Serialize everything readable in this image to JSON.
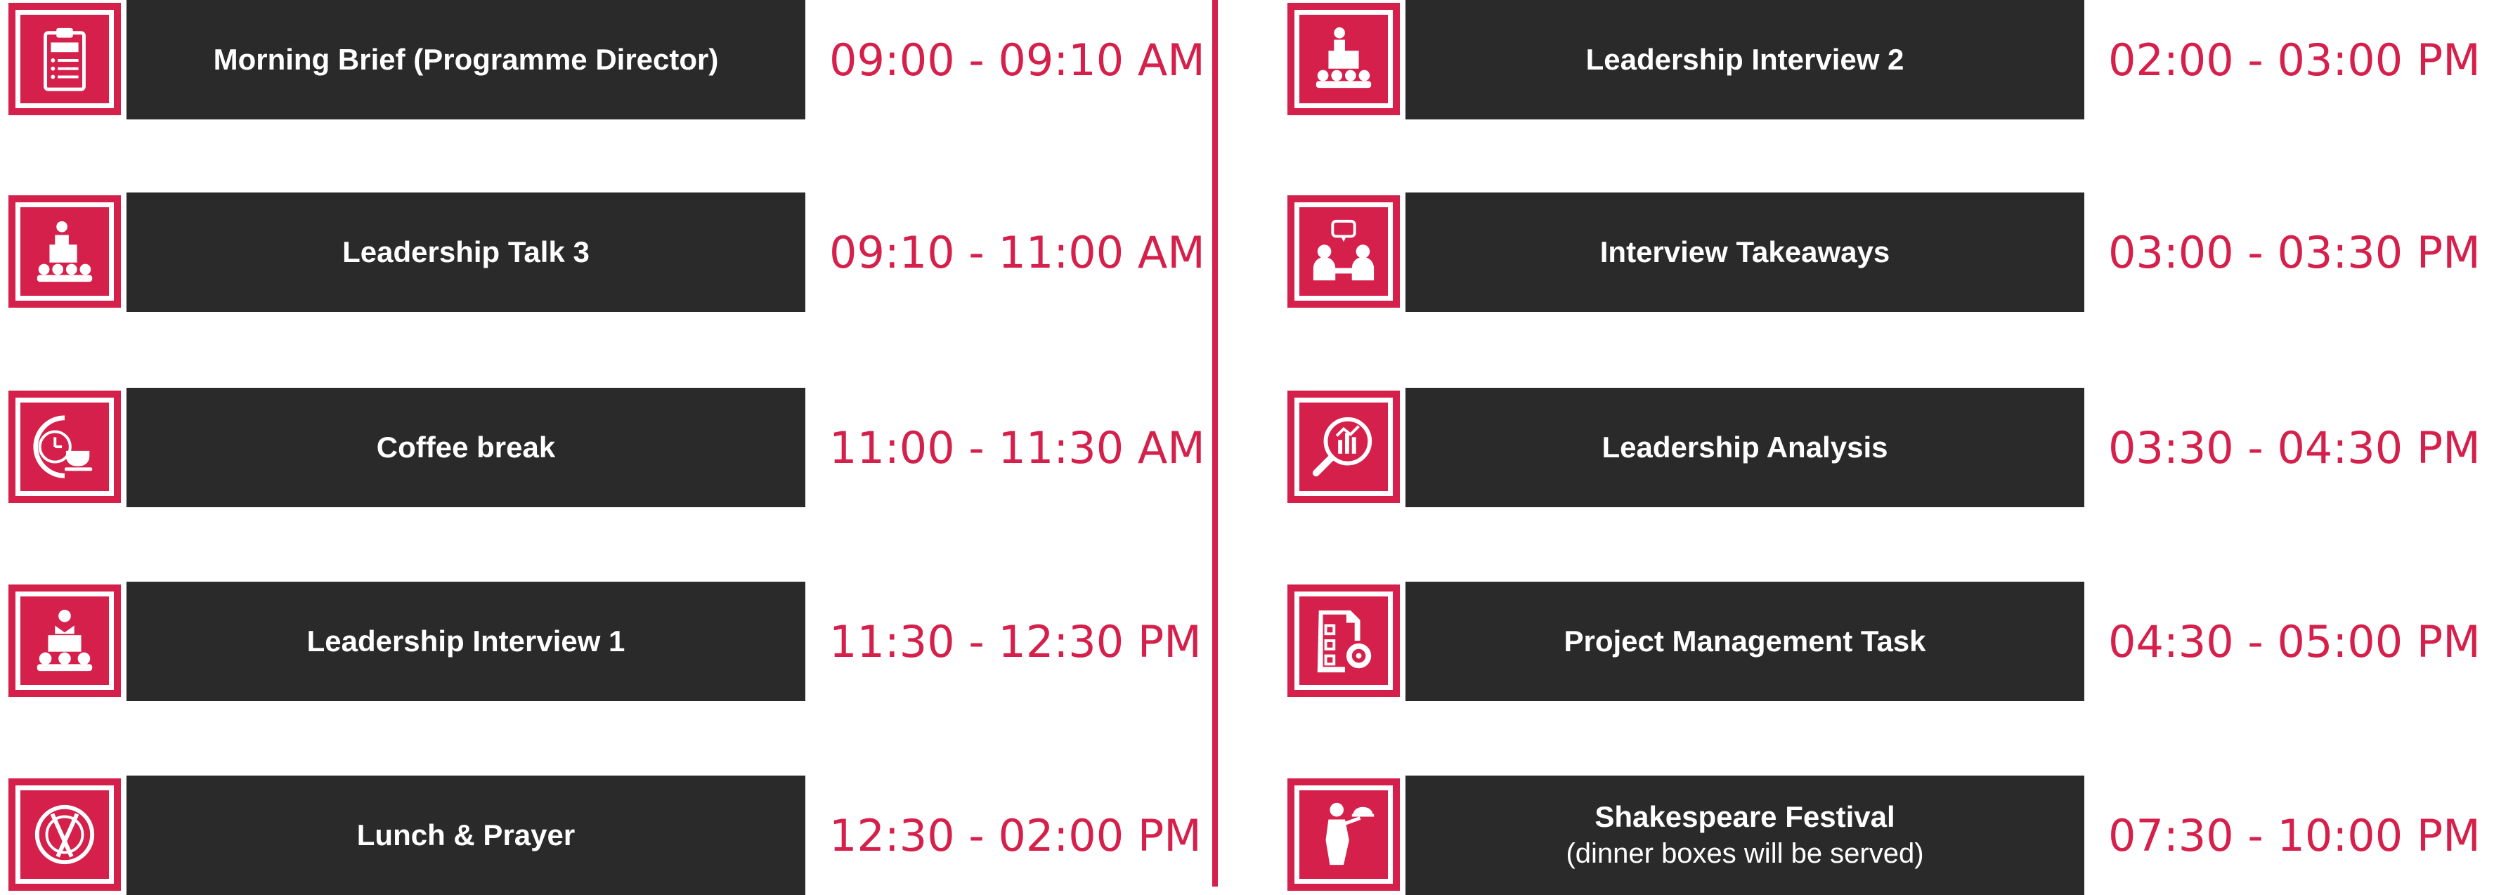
{
  "colors": {
    "accent": "#d4204a",
    "title_bg": "#2a2a2a",
    "title_text": "#ffffff",
    "time_text": "#d4204a"
  },
  "schedule": {
    "left": [
      {
        "icon": "brief-clipboard-icon",
        "title": "Morning Brief (Programme Director)",
        "subtitle": "",
        "time": "09:00 - 09:10 AM"
      },
      {
        "icon": "speaker-podium-icon",
        "title": "Leadership Talk 3",
        "subtitle": "",
        "time": "09:10 - 11:00 AM"
      },
      {
        "icon": "coffee-clock-icon",
        "title": "Coffee break",
        "subtitle": "",
        "time": "11:00 - 11:30 AM"
      },
      {
        "icon": "interview-podium-icon",
        "title": "Leadership Interview 1",
        "subtitle": "",
        "time": "11:30 - 12:30 PM"
      },
      {
        "icon": "plate-cutlery-icon",
        "title": "Lunch & Prayer",
        "subtitle": "",
        "time": "12:30 - 02:00 PM"
      }
    ],
    "right": [
      {
        "icon": "speaker-audience-icon",
        "title": "Leadership Interview 2",
        "subtitle": "",
        "time": "02:00 - 03:00 PM"
      },
      {
        "icon": "discussion-people-icon",
        "title": "Interview Takeaways",
        "subtitle": "",
        "time": "03:00 - 03:30 PM"
      },
      {
        "icon": "analysis-magnifier-icon",
        "title": "Leadership Analysis",
        "subtitle": "",
        "time": "03:30 - 04:30 PM"
      },
      {
        "icon": "checklist-gear-icon",
        "title": "Project Management Task",
        "subtitle": "",
        "time": "04:30 - 05:00 PM"
      },
      {
        "icon": "waiter-tray-icon",
        "title": "Shakespeare Festival",
        "subtitle": "(dinner boxes will be served)",
        "time": "07:30 - 10:00 PM"
      }
    ]
  }
}
